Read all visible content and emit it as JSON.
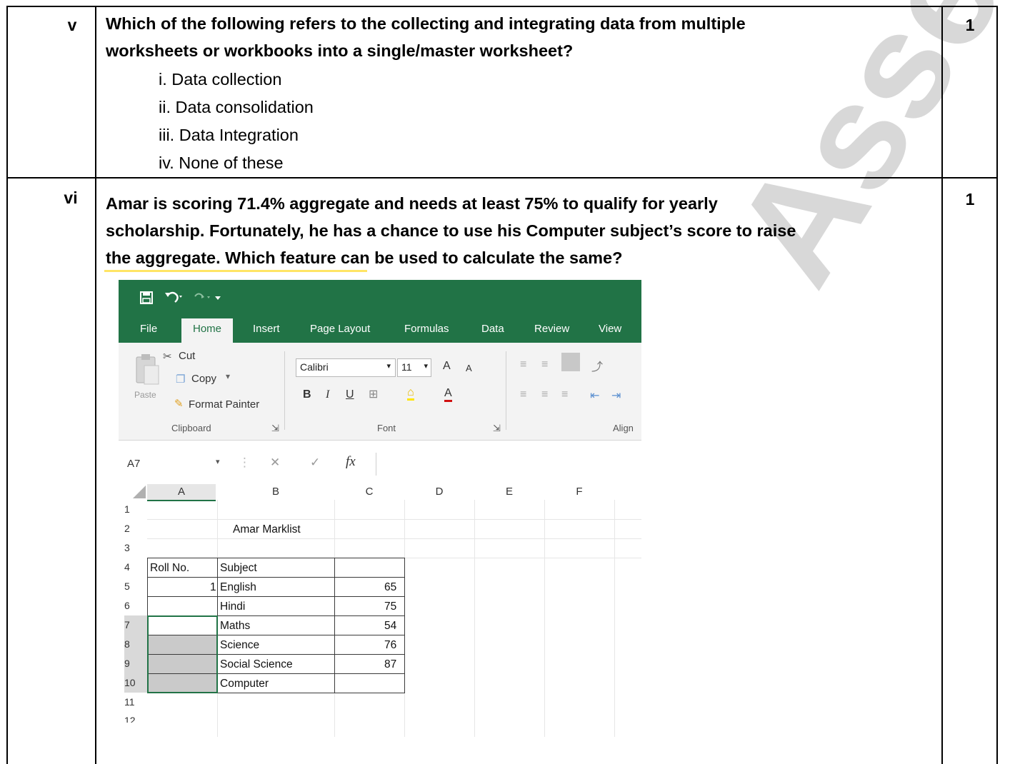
{
  "questions": [
    {
      "number": "v",
      "marks": "1",
      "lines": [
        "Which of the following refers to the collecting and integrating data from multiple",
        "worksheets or workbooks into a single/master worksheet?"
      ],
      "options": [
        "i. Data collection",
        "ii. Data consolidation",
        "iii. Data Integration",
        "iv. None of these"
      ]
    },
    {
      "number": "vi",
      "marks": "1",
      "lines": [
        "Amar is scoring 71.4% aggregate and needs at least 75% to qualify for yearly",
        "scholarship. Fortunately, he has a chance to use his Computer subject’s score to raise",
        "the aggregate. Which feature can be used to calculate the same?"
      ]
    }
  ],
  "excel": {
    "qat_icons": [
      "save-icon",
      "undo-icon",
      "redo-icon",
      "customize-icon"
    ],
    "tabs": [
      "File",
      "Home",
      "Insert",
      "Page Layout",
      "Formulas",
      "Data",
      "Review",
      "View"
    ],
    "active_tab": "Home",
    "clipboard": {
      "paste": "Paste",
      "cut": "Cut",
      "copy": "Copy",
      "format_painter": "Format Painter",
      "group_label": "Clipboard"
    },
    "font": {
      "family": "Calibri",
      "size": "11",
      "grow": "A",
      "shrink": "A",
      "bold": "B",
      "italic": "I",
      "underline": "U",
      "font_color": "A",
      "group_label": "Font"
    },
    "alignment": {
      "group_label": "Align"
    },
    "name_box": "A7",
    "fx_label": "fx",
    "formula_value": "",
    "columns": [
      "A",
      "B",
      "C",
      "D",
      "E",
      "F"
    ],
    "rows": [
      "1",
      "2",
      "3",
      "4",
      "5",
      "6",
      "7",
      "8",
      "9",
      "10",
      "11",
      "12"
    ],
    "cells": {
      "b2": "Amar Marklist",
      "a4": "Roll No.",
      "b4": "Subject",
      "a5": "1",
      "b5": "English",
      "c5": "65",
      "b6": "Hindi",
      "c6": "75",
      "b7": "Maths",
      "c7": "54",
      "b8": "Science",
      "c8": "76",
      "b9": "Social Science",
      "c9": "87",
      "b10": "Computer"
    },
    "colors": {
      "accent": "#217346",
      "ribbon_bg": "#f3f3f3"
    }
  },
  "watermark": "Assessment-II"
}
